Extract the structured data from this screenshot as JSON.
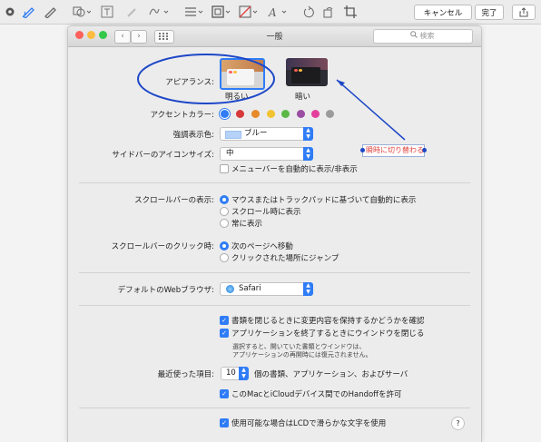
{
  "toolbar": {
    "icons": [
      "close-circle-icon",
      "sketch-icon",
      "draw-icon",
      "shapes-icon",
      "text-box-icon",
      "highlight-icon",
      "sign-icon",
      "shape-style-icon",
      "border-color-icon",
      "fill-color-icon",
      "text-style-icon",
      "rotate-left-icon",
      "rotate-right-icon",
      "crop-icon"
    ],
    "cancel": "キャンセル",
    "done": "完了",
    "share_icon": "share-icon"
  },
  "window": {
    "title": "一般",
    "search_placeholder": "検索",
    "traffic_colors": [
      "#fc605b",
      "#fdbc40",
      "#34c84a"
    ]
  },
  "appearance": {
    "label": "アピアランス:",
    "options": [
      "明るい",
      "暗い"
    ]
  },
  "accent": {
    "label": "アクセントカラー:",
    "colors": [
      "#2f7cf6",
      "#d8393b",
      "#e88a2a",
      "#f2c331",
      "#5cb846",
      "#9a4ea3",
      "#e3409c",
      "#9b9b9b"
    ]
  },
  "highlight": {
    "label": "強調表示色:",
    "value": "ブルー",
    "swatch": "#b5d3f8"
  },
  "sidebar_icon": {
    "label": "サイドバーのアイコンサイズ:",
    "value": "中"
  },
  "menubar_autohide": "メニューバーを自動的に表示/非表示",
  "annotation": {
    "text": "瞬時に切り替わる",
    "color": "#e0453e",
    "stroke": "#1d47c7"
  },
  "scroll_show": {
    "label": "スクロールバーの表示:",
    "options": [
      "マウスまたはトラックパッドに基づいて自動的に表示",
      "スクロール時に表示",
      "常に表示"
    ]
  },
  "scroll_click": {
    "label": "スクロールバーのクリック時:",
    "options": [
      "次のページへ移動",
      "クリックされた場所にジャンプ"
    ]
  },
  "browser": {
    "label": "デフォルトのWebブラウザ:",
    "value": "Safari"
  },
  "docs": {
    "ask_keep": "書類を閉じるときに変更内容を保持するかどうかを確認",
    "close_windows": "アプリケーションを終了するときにウインドウを閉じる",
    "note_line1": "選択すると、開いていた書類とウインドウは、",
    "note_line2": "アプリケーションの再開時には復元されません。"
  },
  "recent": {
    "label": "最近使った項目:",
    "value": "10",
    "suffix": "個の書類、アプリケーション、およびサーバ"
  },
  "handoff": "このMacとiCloudデバイス間でのHandoffを許可",
  "lcd": "使用可能な場合はLCDで滑らかな文字を使用",
  "help": "?"
}
